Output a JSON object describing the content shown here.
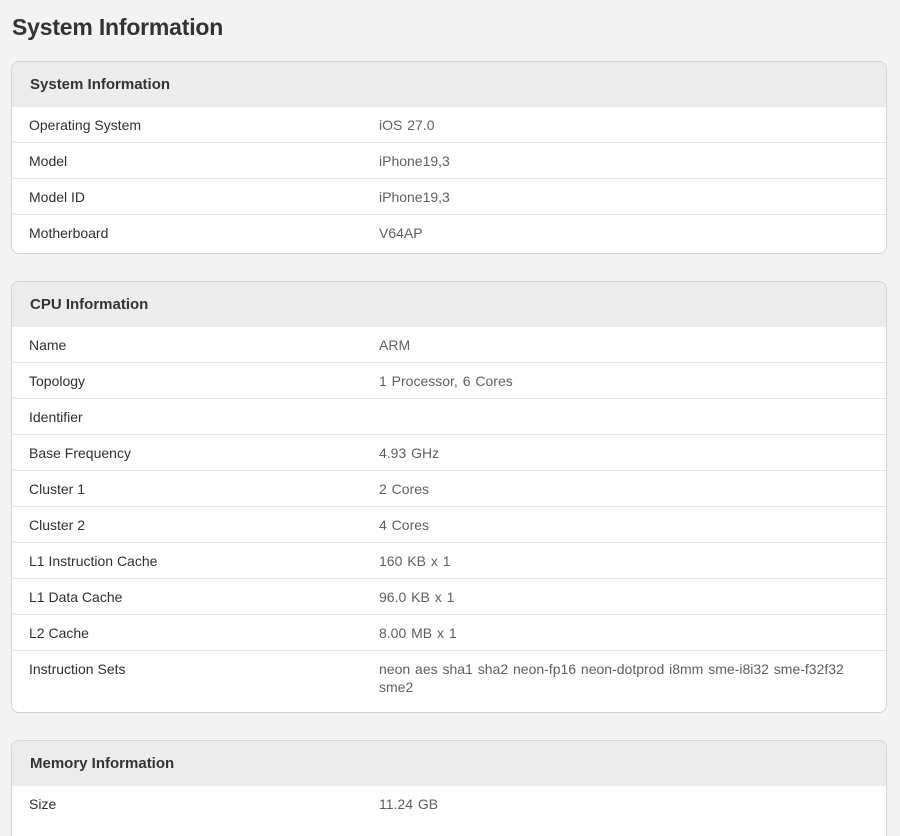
{
  "page": {
    "title": "System Information"
  },
  "sections": {
    "system": {
      "header": "System Information",
      "rows": [
        {
          "label": "Operating System",
          "value": "iOS 27.0"
        },
        {
          "label": "Model",
          "value": "iPhone19,3"
        },
        {
          "label": "Model ID",
          "value": "iPhone19,3"
        },
        {
          "label": "Motherboard",
          "value": "V64AP"
        }
      ]
    },
    "cpu": {
      "header": "CPU Information",
      "rows": [
        {
          "label": "Name",
          "value": "ARM"
        },
        {
          "label": "Topology",
          "value": "1 Processor, 6 Cores"
        },
        {
          "label": "Identifier",
          "value": ""
        },
        {
          "label": "Base Frequency",
          "value": "4.93 GHz"
        },
        {
          "label": "Cluster 1",
          "value": "2 Cores"
        },
        {
          "label": "Cluster 2",
          "value": "4 Cores"
        },
        {
          "label": "L1 Instruction Cache",
          "value": "160 KB x 1"
        },
        {
          "label": "L1 Data Cache",
          "value": "96.0 KB x 1"
        },
        {
          "label": "L2 Cache",
          "value": "8.00 MB x 1"
        },
        {
          "label": "Instruction Sets",
          "value": "neon aes sha1 sha2 neon-fp16 neon-dotprod i8mm sme-i8i32 sme-f32f32 sme2"
        }
      ]
    },
    "memory": {
      "header": "Memory Information",
      "rows": [
        {
          "label": "Size",
          "value": "11.24 GB"
        }
      ]
    }
  }
}
